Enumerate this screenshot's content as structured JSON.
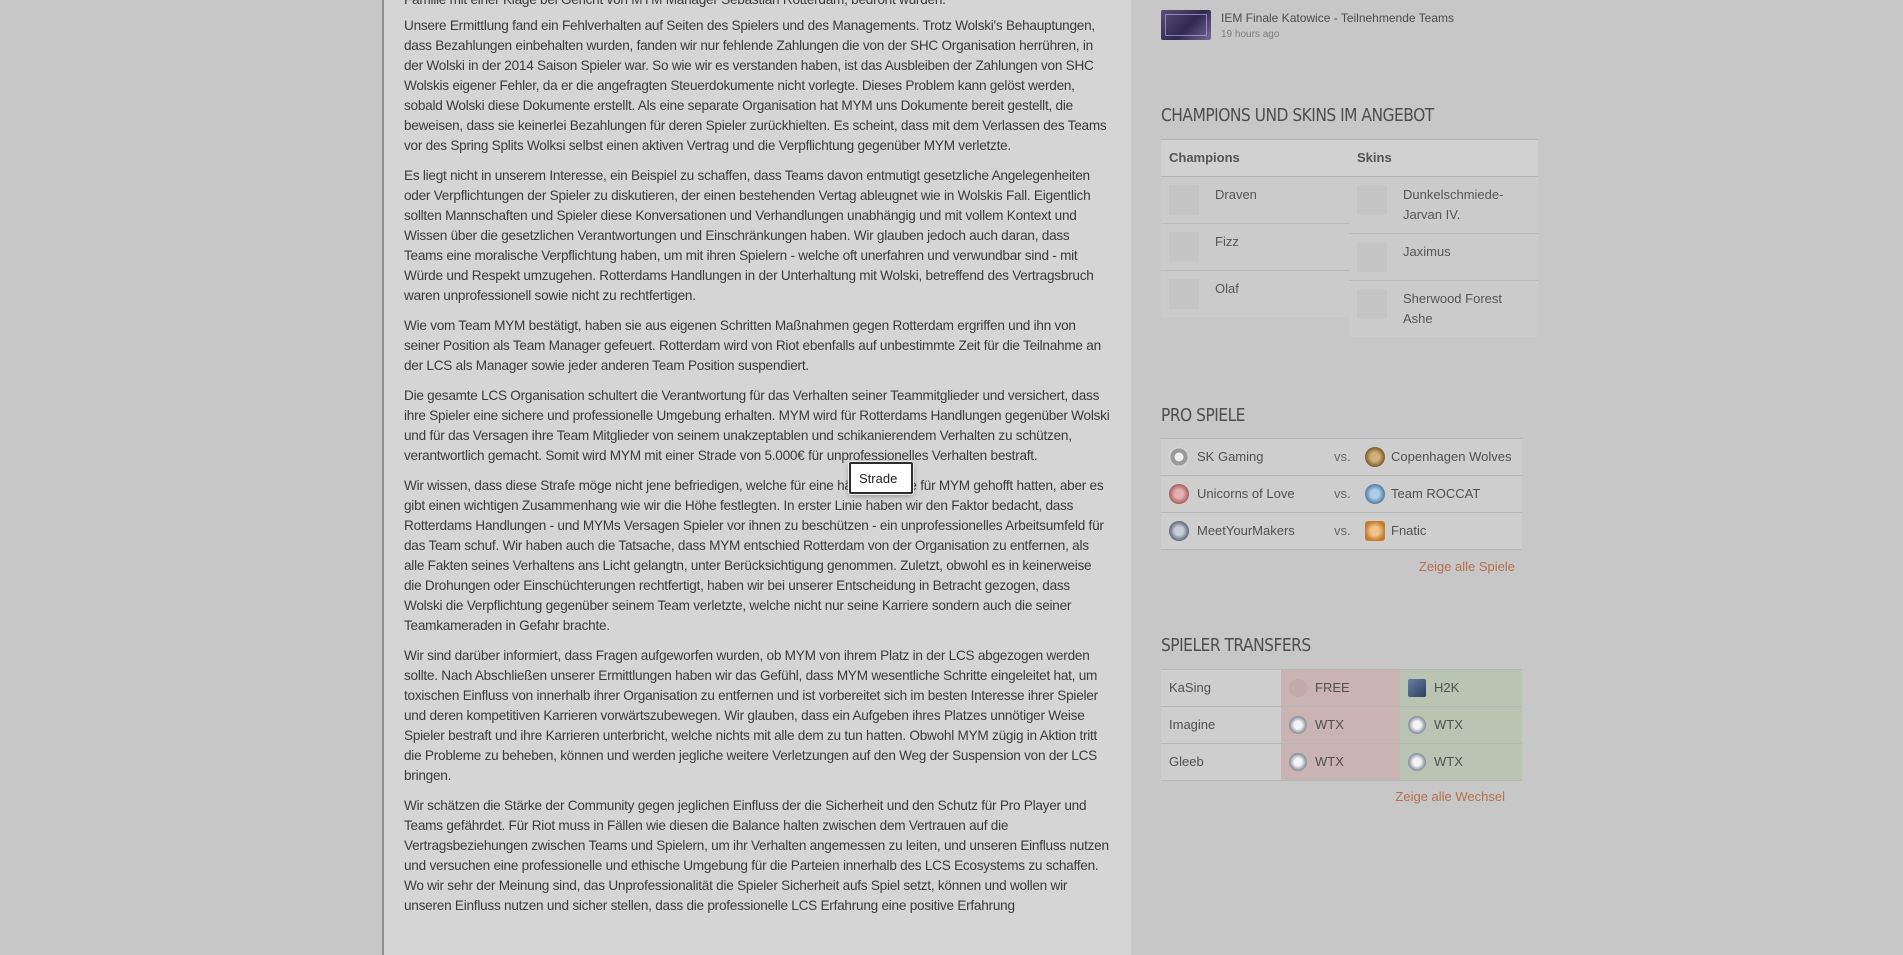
{
  "article": {
    "paragraphs": [
      "Familie mit einer Klage bei Gericht von MYM Manager Sebastian Rotterdam, bedroht wurden.",
      "Unsere Ermittlung fand ein Fehlverhalten auf Seiten des Spielers und des Managements. Trotz Wolski's Behauptungen, dass Bezahlungen einbehalten wurden, fanden wir nur fehlende Zahlungen die von der SHC Organisation herrühren, in der Wolski in der 2014 Saison Spieler war. So wie wir es verstanden haben, ist das Ausbleiben der Zahlungen von SHC Wolskis eigener Fehler, da er die angefragten Steuerdokumente nicht vorlegte. Dieses Problem kann gelöst werden, sobald Wolski diese Dokumente erstellt. Als eine separate Organisation hat MYM uns Dokumente bereit gestellt, die beweisen, dass sie keinerlei Bezahlungen für deren Spieler zurückhielten. Es scheint, dass mit dem Verlassen des Teams vor des Spring Splits Wolksi selbst einen aktiven Vertrag und die Verpflichtung gegenüber MYM verletzte.",
      "Es liegt nicht in unserem Interesse, ein Beispiel zu schaffen, dass Teams davon entmutigt gesetzliche Angelegenheiten oder Verpflichtungen der Spieler zu diskutieren, der einen bestehenden Vertag ableugnet wie in Wolskis Fall. Eigentlich sollten Mannschaften und Spieler diese Konversationen und Verhandlungen unabhängig und mit vollem Kontext und Wissen über die gesetzlichen Verantwortungen und Einschränkungen haben. Wir glauben jedoch auch daran, dass Teams eine moralische Verpflichtung haben, um mit ihren Spielern - welche oft unerfahren und verwundbar sind - mit Würde und Respekt umzugehen. Rotterdams Handlungen in der Unterhaltung mit Wolski, betreffend des Vertragsbruch waren unprofessionell sowie nicht zu rechtfertigen.",
      "Wie vom Team MYM bestätigt, haben sie aus eigenen Schritten Maßnahmen gegen Rotterdam ergriffen und ihn von seiner Position als Team Manager gefeuert. Rotterdam wird von Riot ebenfalls auf unbestimmte Zeit für die Teilnahme an der LCS als Manager sowie jeder anderen Team Position suspendiert.",
      "Die gesamte LCS Organisation schultert die Verantwortung für das Verhalten seiner Teammitglieder und versichert, dass ihre Spieler eine sichere und professionelle Umgebung erhalten. MYM wird für Rotterdams Handlungen gegenüber Wolski und für das Versagen ihre Team Mitglieder von seinem unakzeptablen und  schikanierendem Verhalten zu schützen, verantwortlich gemacht. Somit wird MYM mit einer Strade von 5.000€ für unprofessionelles Verhalten bestraft.",
      "Wir wissen, dass diese Strafe möge nicht jene befriedigen, welche für eine härtere Strafe für MYM gehofft hatten, aber es gibt einen wichtigen Zusammenhang wie wir die Höhe festlegten. In erster Linie haben wir den Faktor bedacht, dass Rotterdams Handlungen - und MYMs Versagen Spieler vor ihnen zu beschützen - ein unprofessionelles Arbeitsumfeld für das Team schuf. Wir haben auch die Tatsache, dass MYM entschied Rotterdam von der Organisation zu entfernen, als alle Fakten seines Verhaltens ans Licht gelangtn, unter Berücksichtigung genommen. Zuletzt, obwohl es in keinerweise die Drohungen oder Einschüchterungen rechtfertigt, haben wir bei unserer Entscheidung in Betracht gezogen, dass Wolski die Verpflichtung gegenüber seinem Team verletzte, welche nicht nur seine Karriere sondern auch die seiner Teamkameraden in Gefahr brachte.",
      "Wir sind darüber informiert, dass Fragen aufgeworfen wurden, ob MYM von ihrem Platz in der LCS abgezogen werden sollte. Nach Abschließen unserer Ermittlungen haben wir das Gefühl, dass MYM wesentliche Schritte eingeleitet hat, um toxischen Einfluss von innerhalb ihrer Organisation zu entfernen und ist vorbereitet sich im  besten Interesse ihrer Spieler und deren kompetitiven Karrieren vorwärtszubewegen. Wir glauben, dass ein Aufgeben ihres Platzes unnötiger Weise Spieler bestraft und ihre Karrieren unterbricht, welche nichts mit alle dem zu tun hatten. Obwohl MYM zügig in Aktion tritt die Probleme zu beheben, können und werden jegliche weitere Verletzungen auf den Weg der Suspension von der LCS bringen.",
      "Wir schätzen die Stärke der Community gegen jeglichen Einfluss der die Sicherheit und den Schutz für Pro Player und Teams gefährdet. Für Riot muss in Fällen wie diesen die Balance halten zwischen dem Vertrauen auf die Vertragsbeziehungen zwischen Teams und Spielern, um ihr Verhalten angemessen zu leiten, und unseren Einfluss nutzen und versuchen eine professionelle und ethische Umgebung für die Parteien innerhalb des LCS Ecosystems zu schaffen. Wo wir sehr der Meinung sind, das Unprofessionalität die Spieler Sicherheit aufs Spiel setzt, können und wollen wir unseren Einfluss nutzen und sicher stellen, dass die professionelle LCS Erfahrung eine positive Erfahrung"
    ]
  },
  "tooltip": {
    "text": "Strade"
  },
  "news": {
    "title": "IEM Finale Katowice - Teilnehmende Teams",
    "time": "19 hours ago",
    "thumb_icon": "iem-katowice-thumbnail"
  },
  "champions_section": {
    "title": "Champions und Skins im Angebot",
    "champions_header": "Champions",
    "skins_header": "Skins",
    "champions": [
      "Draven",
      "Fizz",
      "Olaf"
    ],
    "skins": [
      "Dunkelschmiede-Jarvan IV.",
      "Jaximus",
      "Sherwood Forest Ashe"
    ]
  },
  "pro_games": {
    "title": "Pro Spiele",
    "vs_label": "vs.",
    "matches": [
      {
        "team1": "SK Gaming",
        "team2": "Copenhagen Wolves"
      },
      {
        "team1": "Unicorns of Love",
        "team2": "Team ROCCAT"
      },
      {
        "team1": "MeetYourMakers",
        "team2": "Fnatic"
      }
    ],
    "more_link": "Zeige alle Spiele"
  },
  "transfers": {
    "title": "Spieler Transfers",
    "rows": [
      {
        "player": "KaSing",
        "from": "FREE",
        "to": "H2K"
      },
      {
        "player": "Imagine",
        "from": "WTX",
        "to": "WTX"
      },
      {
        "player": "Gleeb",
        "from": "WTX",
        "to": "WTX"
      }
    ],
    "more_link": "Zeige alle Wechsel"
  },
  "colors": {
    "link": "#b5704f",
    "transfer_from_bg": "#c9b3b3",
    "transfer_to_bg": "#b9c4b2"
  }
}
